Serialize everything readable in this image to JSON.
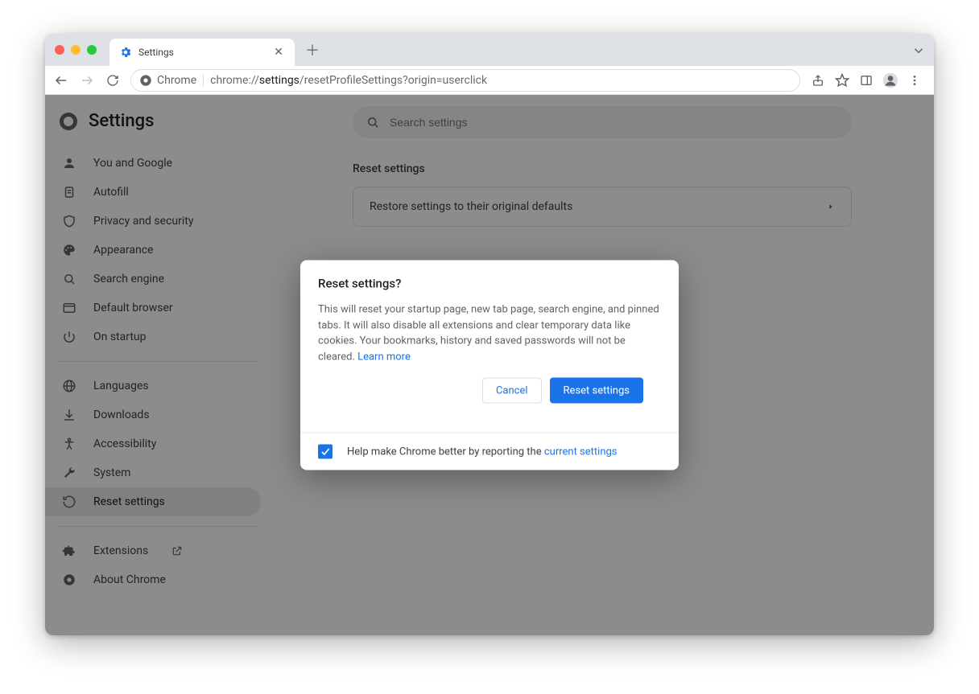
{
  "browser": {
    "tab": {
      "title": "Settings"
    },
    "toolbar": {
      "site_label": "Chrome",
      "url_prefix": "chrome://",
      "url_bold": "settings",
      "url_suffix": "/resetProfileSettings?origin=userclick"
    }
  },
  "page": {
    "title": "Settings",
    "search_placeholder": "Search settings",
    "sidebar": {
      "group1": [
        {
          "label": "You and Google"
        },
        {
          "label": "Autofill"
        },
        {
          "label": "Privacy and security"
        },
        {
          "label": "Appearance"
        },
        {
          "label": "Search engine"
        },
        {
          "label": "Default browser"
        },
        {
          "label": "On startup"
        }
      ],
      "group2": [
        {
          "label": "Languages"
        },
        {
          "label": "Downloads"
        },
        {
          "label": "Accessibility"
        },
        {
          "label": "System"
        },
        {
          "label": "Reset settings"
        }
      ],
      "group3": [
        {
          "label": "Extensions"
        },
        {
          "label": "About Chrome"
        }
      ]
    },
    "section": {
      "title": "Reset settings",
      "row_label": "Restore settings to their original defaults"
    }
  },
  "dialog": {
    "title": "Reset settings?",
    "body": "This will reset your startup page, new tab page, search engine, and pinned tabs. It will also disable all extensions and clear temporary data like cookies. Your bookmarks, history and saved passwords will not be cleared. ",
    "learn_more": "Learn more",
    "cancel": "Cancel",
    "confirm": "Reset settings",
    "footer_text": "Help make Chrome better by reporting the ",
    "footer_link": "current settings",
    "checkbox_checked": true
  }
}
